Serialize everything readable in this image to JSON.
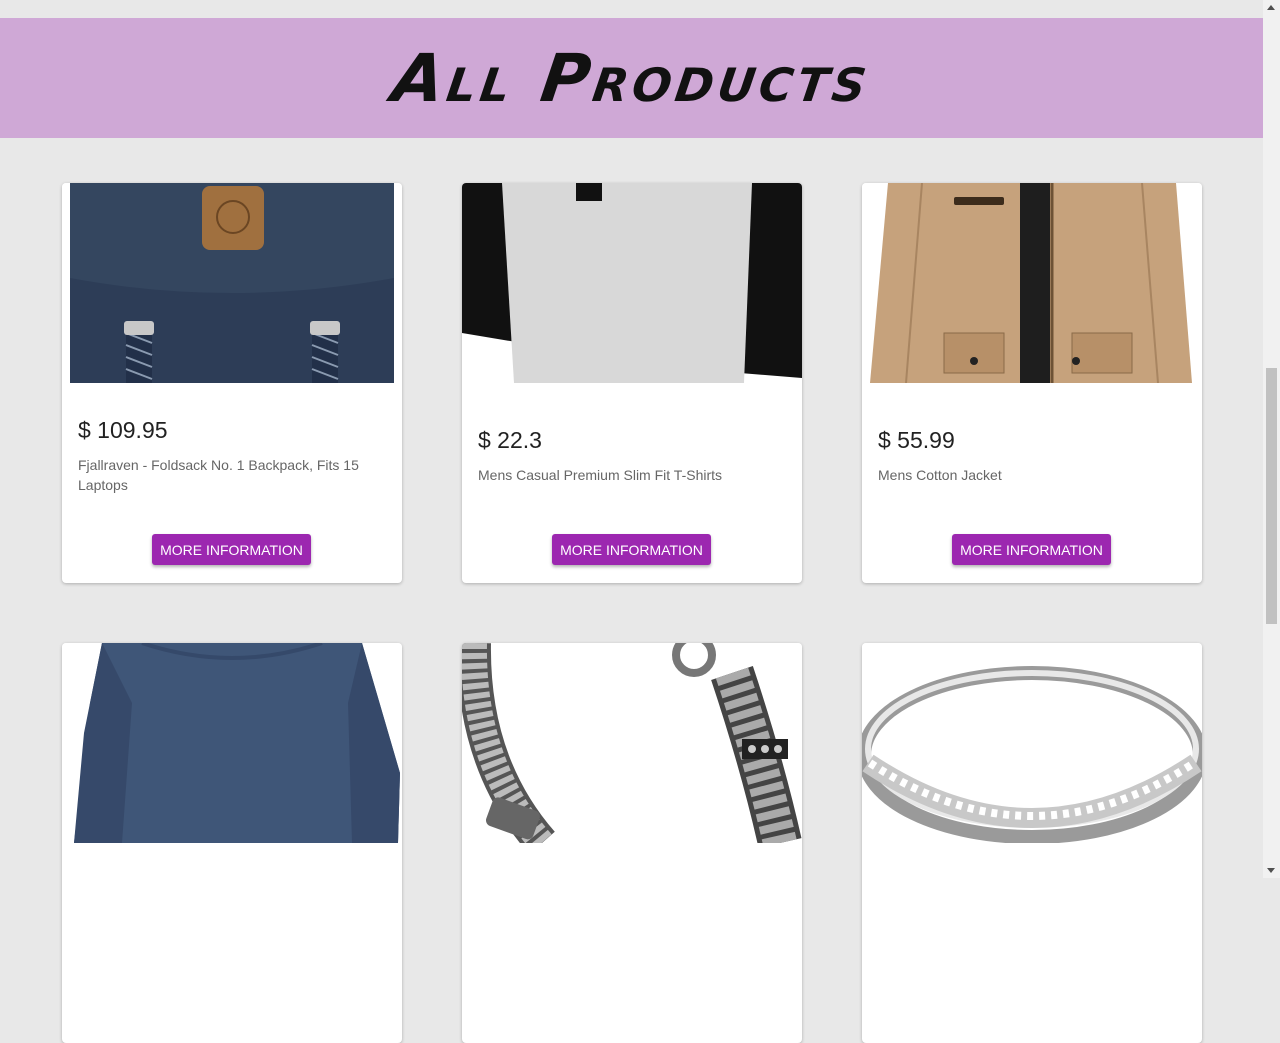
{
  "header": {
    "title": "All Products"
  },
  "products": [
    {
      "price": "$ 109.95",
      "title": "Fjallraven - Foldsack No. 1 Backpack, Fits 15 Laptops",
      "button": "MORE INFORMATION",
      "image": "backpack-image"
    },
    {
      "price": "$ 22.3",
      "title": "Mens Casual Premium Slim Fit T-Shirts",
      "button": "MORE INFORMATION",
      "image": "tshirt-image"
    },
    {
      "price": "$ 55.99",
      "title": "Mens Cotton Jacket",
      "button": "MORE INFORMATION",
      "image": "jacket-image"
    },
    {
      "image": "longsleeve-shirt-image"
    },
    {
      "image": "bracelet-image"
    },
    {
      "image": "ring-image"
    }
  ],
  "colors": {
    "header_bg": "#cfa8d6",
    "button_bg": "#9c27b0",
    "page_bg": "#e8e8e8"
  }
}
